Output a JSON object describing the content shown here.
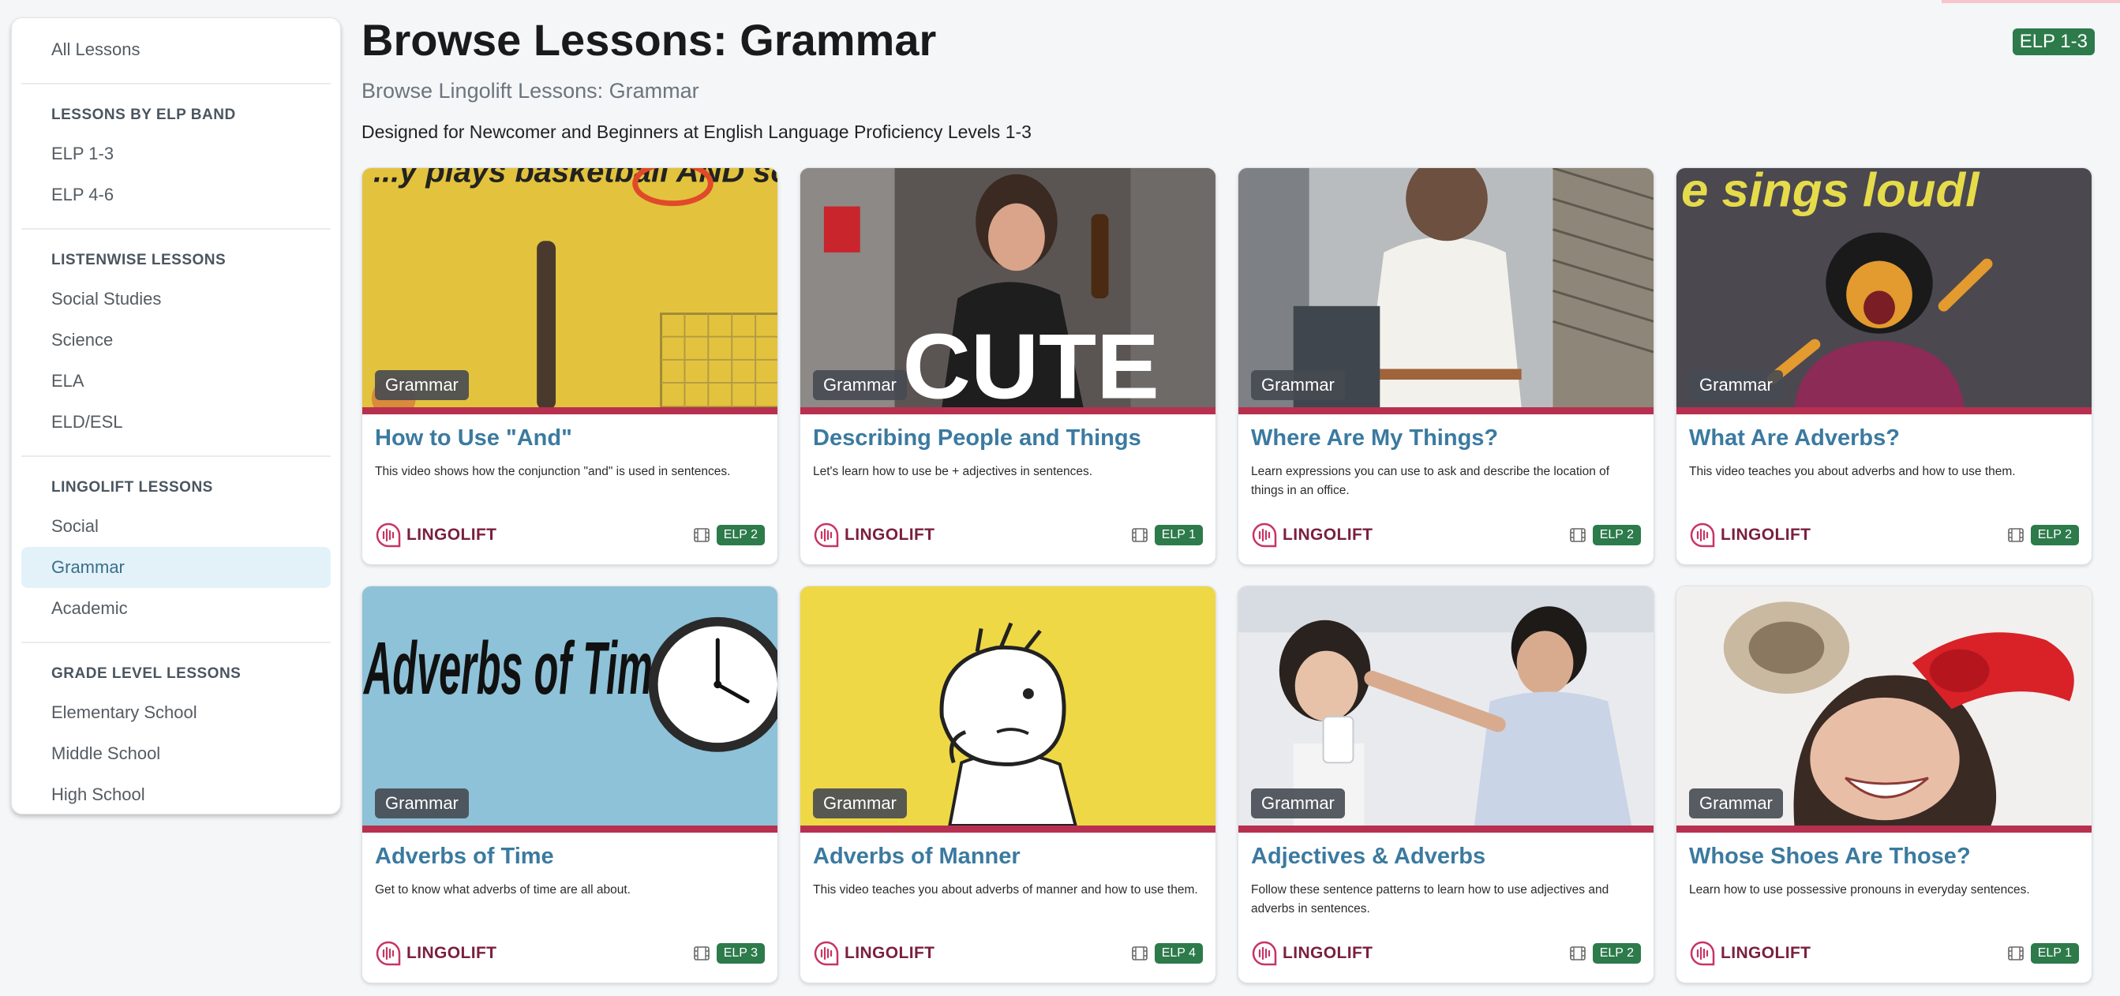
{
  "sidebar": {
    "top_item": "All Lessons",
    "sections": [
      {
        "header": "LESSONS BY ELP BAND",
        "items": [
          "ELP 1-3",
          "ELP 4-6"
        ]
      },
      {
        "header": "LISTENWISE LESSONS",
        "items": [
          "Social Studies",
          "Science",
          "ELA",
          "ELD/ESL"
        ]
      },
      {
        "header": "LINGOLIFT LESSONS",
        "items": [
          "Social",
          "Grammar",
          "Academic"
        ]
      },
      {
        "header": "GRADE LEVEL LESSONS",
        "items": [
          "Elementary School",
          "Middle School",
          "High School"
        ]
      }
    ],
    "active_item": "Grammar"
  },
  "header": {
    "title": "Browse Lessons: Grammar",
    "subtitle": "Browse Lingolift Lessons: Grammar",
    "description": "Designed for Newcomer and Beginners at English Language Proficiency Levels 1-3",
    "elp_badge": "ELP 1-3"
  },
  "cards": [
    {
      "category": "Grammar",
      "title": "How to Use \"And\"",
      "description": "This video shows how the conjunction \"and\" is used in sentences.",
      "brand": "LINGOLIFT",
      "elp": "ELP 2",
      "thumb_text": "...y plays basketball AND soc..."
    },
    {
      "category": "Grammar",
      "title": "Describing People and Things",
      "description": "Let's learn how to use be + adjectives in sentences.",
      "brand": "LINGOLIFT",
      "elp": "ELP 1",
      "thumb_text": "CUTE"
    },
    {
      "category": "Grammar",
      "title": "Where Are My Things?",
      "description": "Learn expressions you can use to ask and describe the location of things in an office.",
      "brand": "LINGOLIFT",
      "elp": "ELP 2",
      "thumb_text": ""
    },
    {
      "category": "Grammar",
      "title": "What Are Adverbs?",
      "description": "This video teaches you about adverbs and how to use them.",
      "brand": "LINGOLIFT",
      "elp": "ELP 2",
      "thumb_text": "e sings loudl"
    },
    {
      "category": "Grammar",
      "title": "Adverbs of Time",
      "description": "Get to know what adverbs of time are all about.",
      "brand": "LINGOLIFT",
      "elp": "ELP 3",
      "thumb_text": "Adverbs of Time"
    },
    {
      "category": "Grammar",
      "title": "Adverbs of Manner",
      "description": "This video teaches you about adverbs of manner and how to use them.",
      "brand": "LINGOLIFT",
      "elp": "ELP 4",
      "thumb_text": ""
    },
    {
      "category": "Grammar",
      "title": "Adjectives & Adverbs",
      "description": "Follow these sentence patterns to learn how to use adjectives and adverbs in sentences.",
      "brand": "LINGOLIFT",
      "elp": "ELP 2",
      "thumb_text": ""
    },
    {
      "category": "Grammar",
      "title": "Whose Shoes Are Those?",
      "description": "Learn how to use possessive pronouns in everyday sentences.",
      "brand": "LINGOLIFT",
      "elp": "ELP 1",
      "thumb_text": ""
    }
  ],
  "icons": {
    "brand_logo": "lingolift-logo-icon",
    "media_type": "film-icon"
  },
  "colors": {
    "accent_bar": "#b8304f",
    "elp_badge": "#2d7a4b",
    "card_title": "#3b7aa0",
    "brand_text": "#7a1f3d",
    "active_nav_bg": "#e3f2f9"
  }
}
